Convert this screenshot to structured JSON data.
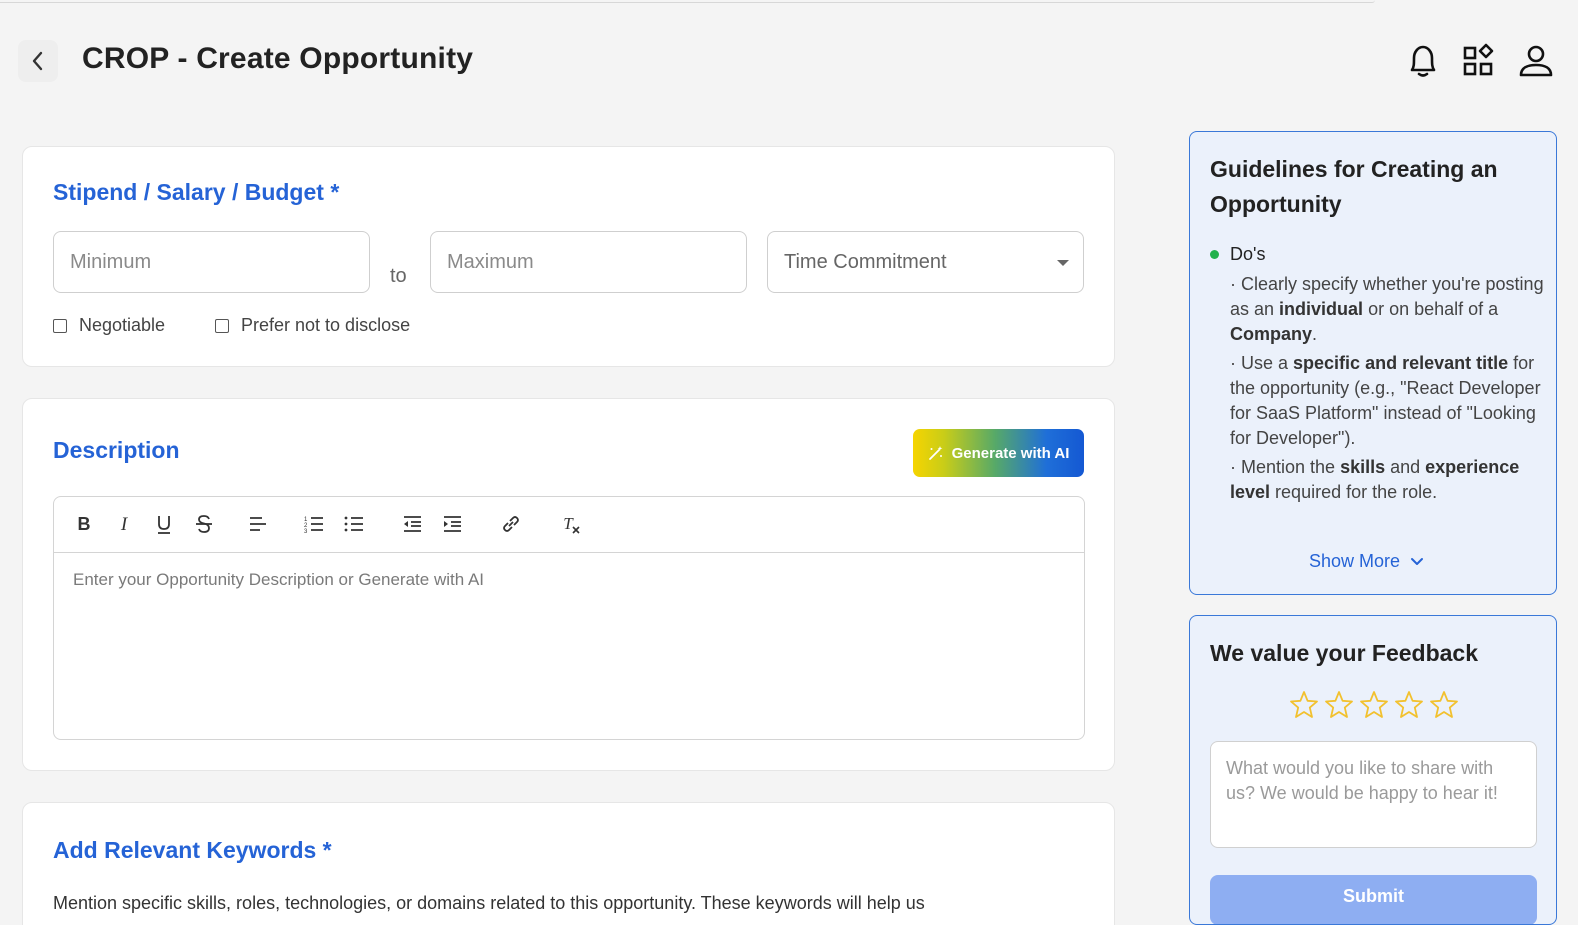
{
  "header": {
    "title": "CROP - Create Opportunity"
  },
  "stipend": {
    "title": "Stipend / Salary / Budget *",
    "minimum_placeholder": "Minimum",
    "to_label": "to",
    "maximum_placeholder": "Maximum",
    "time_commitment": "Time Commitment",
    "negotiable_label": "Negotiable",
    "negotiable_checked": false,
    "prefer_not_label": "Prefer not to disclose",
    "prefer_not_checked": false
  },
  "description": {
    "title": "Description",
    "ai_button": "Generate with AI",
    "placeholder": "Enter your Opportunity Description or Generate with AI",
    "toolbar": [
      "bold-icon",
      "italic-icon",
      "underline-icon",
      "strikethrough-icon",
      "align-left-icon",
      "ordered-list-icon",
      "bullet-list-icon",
      "outdent-icon",
      "indent-icon",
      "link-icon",
      "clear-format-icon"
    ]
  },
  "keywords": {
    "title": "Add Relevant Keywords *",
    "text": "Mention specific skills, roles, technologies, or domains related to this opportunity. These keywords will help us"
  },
  "guidelines": {
    "title": "Guidelines for Creating an Opportunity",
    "dos_label": "Do's",
    "bullets": [
      {
        "a": "· Clearly specify whether you're posting as an ",
        "b": "individual",
        "c": " or on behalf of a ",
        "d": "Company",
        "e": "."
      },
      {
        "a": "· Use a ",
        "b": "specific and relevant title",
        "c": " for the opportunity (e.g., \"React Developer for SaaS Platform\" instead of \"Looking for Developer\")."
      },
      {
        "a": "· Mention the ",
        "b": "skills",
        "c": " and ",
        "d": "experience level",
        "e": " required for the role."
      }
    ],
    "show_more": "Show More"
  },
  "feedback": {
    "title": "We value your Feedback",
    "rating": 0,
    "max_rating": 5,
    "placeholder": "What would you like to share with us? We would be happy to hear it!",
    "submit": "Submit"
  },
  "colors": {
    "accent": "#2563d6",
    "panel_bg": "#ebf1fb",
    "panel_border": "#3a78d8",
    "star": "#f2c12e",
    "submit_bg": "#8eaef2"
  }
}
